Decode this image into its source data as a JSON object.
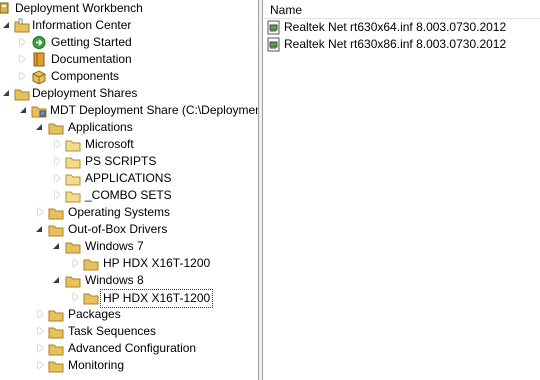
{
  "tree": {
    "workbench": "Deployment Workbench",
    "information_center": "Information Center",
    "getting_started": "Getting Started",
    "documentation": "Documentation",
    "components": "Components",
    "deployment_shares": "Deployment Shares",
    "mdt_share": "MDT Deployment Share (C:\\DeploymentS",
    "applications": "Applications",
    "microsoft": "Microsoft",
    "ps_scripts": "PS SCRIPTS",
    "applications_sub": "APPLICATIONS",
    "combo_sets": "_COMBO SETS",
    "operating_systems": "Operating Systems",
    "out_of_box_drivers": "Out-of-Box Drivers",
    "windows7": "Windows 7",
    "hp_hdx_w7": "HP HDX X16T-1200",
    "windows8": "Windows 8",
    "hp_hdx_w8": "HP HDX X16T-1200",
    "packages": "Packages",
    "task_sequences": "Task Sequences",
    "advanced_configuration": "Advanced Configuration",
    "monitoring": "Monitoring"
  },
  "list": {
    "column_name": "Name",
    "items": [
      "Realtek Net rt630x64.inf 8.003.0730.2012",
      "Realtek Net rt630x86.inf 8.003.0730.2012"
    ]
  }
}
